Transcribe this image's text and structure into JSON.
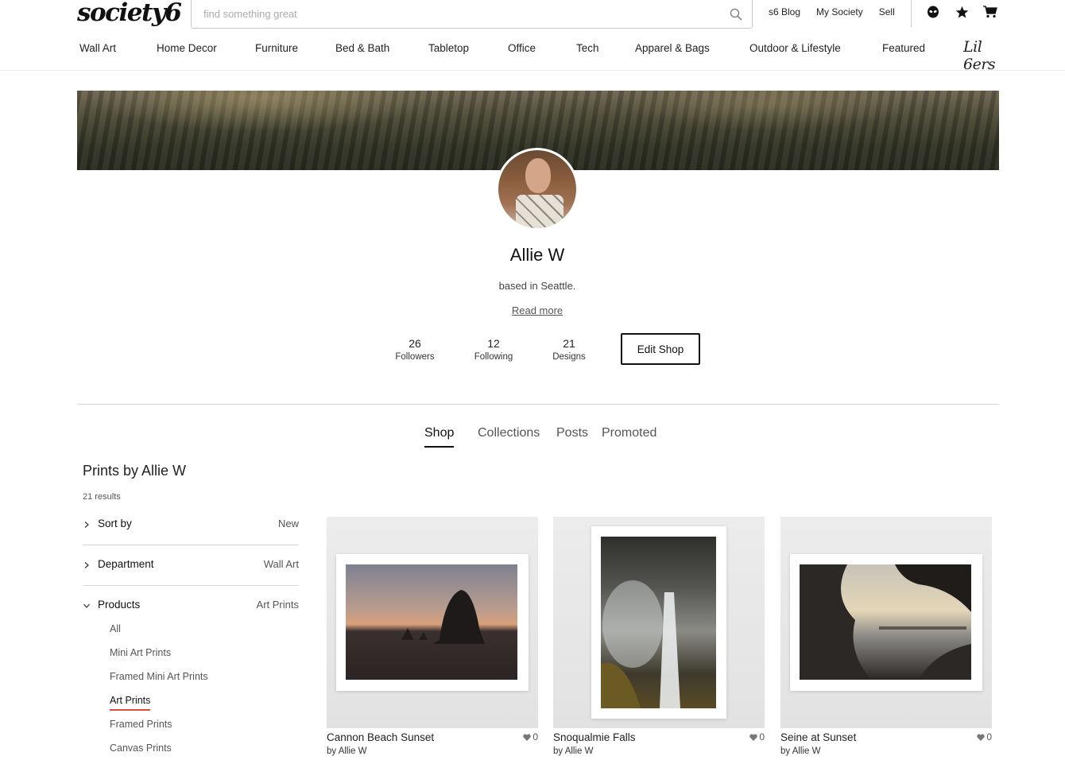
{
  "header": {
    "logo": "society6",
    "search_placeholder": "find something great",
    "links": [
      "s6 Blog",
      "My Society",
      "Sell"
    ],
    "icons": [
      "alien-icon",
      "star-icon",
      "cart-icon"
    ]
  },
  "nav": {
    "items": [
      "Wall Art",
      "Home Decor",
      "Furniture",
      "Bed & Bath",
      "Tabletop",
      "Office",
      "Tech",
      "Apparel & Bags",
      "Outdoor & Lifestyle",
      "Featured"
    ],
    "lil": "Lil 6ers"
  },
  "profile": {
    "name": "Allie W",
    "bio": "based in Seattle.",
    "read_more": "Read more",
    "stats": [
      {
        "value": "26",
        "label": "Followers"
      },
      {
        "value": "12",
        "label": "Following"
      },
      {
        "value": "21",
        "label": "Designs"
      }
    ],
    "edit_button": "Edit Shop"
  },
  "tabs": [
    "Shop",
    "Collections",
    "Posts",
    "Promoted"
  ],
  "sidebar": {
    "title": "Prints by Allie W",
    "results": "21 results",
    "filters": [
      {
        "label": "Sort by",
        "value": "New"
      },
      {
        "label": "Department",
        "value": "Wall Art"
      },
      {
        "label": "Products",
        "value": "Art Prints"
      }
    ],
    "products": [
      "All",
      "Mini Art Prints",
      "Framed Mini Art Prints",
      "Art Prints",
      "Framed Prints",
      "Canvas Prints"
    ]
  },
  "items": [
    {
      "title": "Cannon Beach Sunset",
      "by": "by Allie W",
      "likes": "0"
    },
    {
      "title": "Snoqualmie Falls",
      "by": "by Allie W",
      "likes": "0"
    },
    {
      "title": "Seine at Sunset",
      "by": "by Allie W",
      "likes": "0"
    }
  ],
  "colors": {
    "accent": "#e24a3b",
    "text": "#222222"
  }
}
